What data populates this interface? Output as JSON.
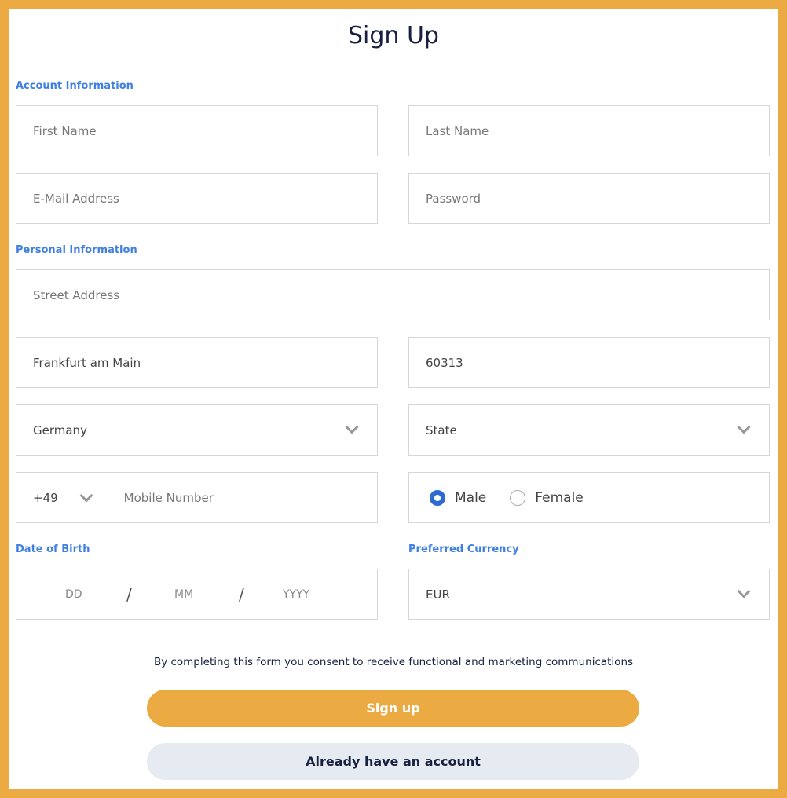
{
  "title": "Sign Up",
  "sections": {
    "account": "Account Information",
    "personal": "Personal Information",
    "dob": "Date of Birth",
    "currency": "Preferred Currency"
  },
  "fields": {
    "first_name": {
      "placeholder": "First Name"
    },
    "last_name": {
      "placeholder": "Last Name"
    },
    "email": {
      "placeholder": "E-Mail Address"
    },
    "password": {
      "placeholder": "Password"
    },
    "street": {
      "placeholder": "Street Address"
    },
    "city": {
      "value": "Frankfurt am Main"
    },
    "zip": {
      "value": "60313"
    },
    "country": {
      "value": "Germany"
    },
    "state": {
      "placeholder": "State"
    },
    "phone_code": {
      "value": "+49"
    },
    "mobile": {
      "placeholder": "Mobile Number"
    },
    "gender": {
      "options": [
        "Male",
        "Female"
      ],
      "selected": "Male"
    },
    "dob": {
      "dd": "DD",
      "mm": "MM",
      "yyyy": "YYYY",
      "sep": "/"
    },
    "currency": {
      "value": "EUR"
    }
  },
  "consent": "By completing this form you consent to receive functional and marketing communications",
  "buttons": {
    "signup": "Sign up",
    "login": "Already have an account"
  },
  "colors": {
    "accent": "#ecaa43",
    "label": "#3f7fe0",
    "radio": "#2e6bd1",
    "secondary_button": "#e6ebf2"
  }
}
